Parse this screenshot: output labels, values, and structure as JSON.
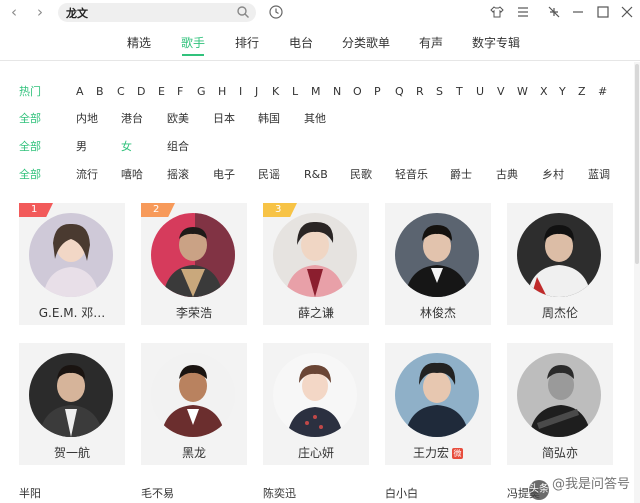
{
  "search": {
    "value": "龙文"
  },
  "tabs": [
    "精选",
    "歌手",
    "排行",
    "电台",
    "分类歌单",
    "有声",
    "数字专辑"
  ],
  "active_tab": "歌手",
  "filters": {
    "initial": {
      "label": "热门",
      "items": [
        "A",
        "B",
        "C",
        "D",
        "E",
        "F",
        "G",
        "H",
        "I",
        "J",
        "K",
        "L",
        "M",
        "N",
        "O",
        "P",
        "Q",
        "R",
        "S",
        "T",
        "U",
        "V",
        "W",
        "X",
        "Y",
        "Z",
        "#"
      ]
    },
    "region": {
      "label": "全部",
      "items": [
        "内地",
        "港台",
        "欧美",
        "日本",
        "韩国",
        "其他"
      ]
    },
    "gender": {
      "label": "全部",
      "items": [
        "男",
        "女",
        "组合"
      ]
    },
    "genre": {
      "label": "全部",
      "items": [
        "流行",
        "嘻哈",
        "摇滚",
        "电子",
        "民谣",
        "R&B",
        "民歌",
        "轻音乐",
        "爵士",
        "古典",
        "乡村",
        "蓝调"
      ]
    }
  },
  "singers_row1": [
    {
      "name": "G.E.M. 邓…",
      "rank": "1"
    },
    {
      "name": "李荣浩",
      "rank": "2"
    },
    {
      "name": "薛之谦",
      "rank": "3"
    },
    {
      "name": "林俊杰",
      "rank": ""
    },
    {
      "name": "周杰伦",
      "rank": ""
    }
  ],
  "singers_row2": [
    {
      "name": "贺一航"
    },
    {
      "name": "黑龙"
    },
    {
      "name": "庄心妍"
    },
    {
      "name": "王力宏"
    },
    {
      "name": "简弘亦"
    }
  ],
  "singer_badge": "微",
  "singers_row3": [
    "半阳",
    "毛不易",
    "陈奕迅",
    "白小白",
    "冯提莫"
  ],
  "watermark": {
    "logo": "头条",
    "text": "@我是问答号"
  },
  "colors": {
    "accent": "#31c27c",
    "rank1": "#f25a5a",
    "rank2": "#f79a5a",
    "rank3": "#f7c346",
    "card_bg": "#f3f3f3"
  },
  "icons": [
    "search-icon",
    "history-icon",
    "skin-icon",
    "menu-icon",
    "mini-mode-icon",
    "minimize-icon",
    "maximize-icon",
    "close-icon"
  ]
}
